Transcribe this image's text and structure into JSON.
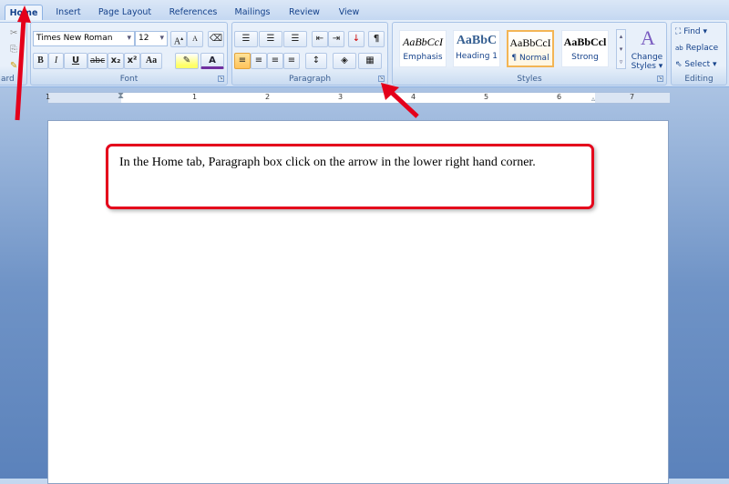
{
  "tabs": [
    "Home",
    "Insert",
    "Page Layout",
    "References",
    "Mailings",
    "Review",
    "View"
  ],
  "font": {
    "name": "Times New Roman",
    "size": "12",
    "group_label": "Font",
    "buttons": [
      "B",
      "I",
      "U",
      "abc",
      "x₂",
      "x²",
      "Aa"
    ]
  },
  "clipboard": {
    "group_label": "ard"
  },
  "paragraph": {
    "group_label": "Paragraph",
    "show_marks": "¶"
  },
  "styles": {
    "group_label": "Styles",
    "items": [
      {
        "preview": "AaBbCcI",
        "name": "Emphasis"
      },
      {
        "preview": "AaBbC",
        "name": "Heading 1"
      },
      {
        "preview": "AaBbCcI",
        "name": "¶ Normal"
      },
      {
        "preview": "AaBbCcl",
        "name": "Strong"
      }
    ],
    "change_styles": "Change Styles ▾"
  },
  "editing": {
    "group_label": "Editing",
    "find": "Find ▾",
    "replace": "Replace",
    "select": "Select ▾"
  },
  "ruler": {
    "numbers": [
      "1",
      "1",
      "2",
      "3",
      "4",
      "5",
      "6",
      "7"
    ]
  },
  "callout": {
    "text": "In the Home tab, Paragraph box click on the arrow in the lower right hand corner."
  },
  "colors": {
    "annotation": "#e4001b",
    "ribbon": "#dbe7f7"
  }
}
